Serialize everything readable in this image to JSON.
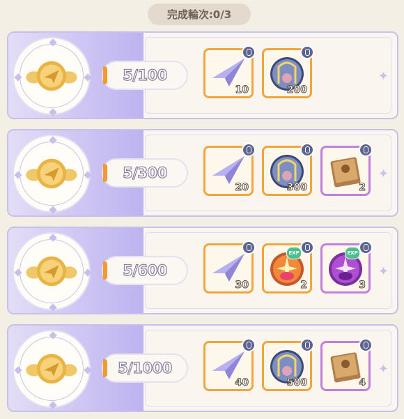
{
  "header": {
    "rounds_label": "完成輪次:0/3"
  },
  "tiers": [
    {
      "progress": "5/100",
      "progress_fraction": 0.05,
      "rewards": [
        {
          "icon": "paper-plane-icon",
          "count": "10",
          "frame": "orange"
        },
        {
          "icon": "crystal-ball-icon",
          "count": "200",
          "frame": "orange"
        }
      ]
    },
    {
      "progress": "5/300",
      "progress_fraction": 0.0167,
      "rewards": [
        {
          "icon": "paper-plane-icon",
          "count": "20",
          "frame": "orange"
        },
        {
          "icon": "crystal-ball-icon",
          "count": "300",
          "frame": "orange"
        },
        {
          "icon": "book-icon",
          "count": "2",
          "frame": "purple"
        }
      ]
    },
    {
      "progress": "5/600",
      "progress_fraction": 0.0083,
      "rewards": [
        {
          "icon": "paper-plane-icon",
          "count": "30",
          "frame": "orange"
        },
        {
          "icon": "exp-orb-orange-icon",
          "count": "2",
          "frame": "orange",
          "badge": "EXP"
        },
        {
          "icon": "exp-orb-purple-icon",
          "count": "3",
          "frame": "purple",
          "badge": "EXP"
        }
      ]
    },
    {
      "progress": "5/1000",
      "progress_fraction": 0.005,
      "rewards": [
        {
          "icon": "paper-plane-icon",
          "count": "40",
          "frame": "orange"
        },
        {
          "icon": "crystal-ball-icon",
          "count": "500",
          "frame": "orange"
        },
        {
          "icon": "book-icon",
          "count": "4",
          "frame": "purple"
        }
      ]
    }
  ],
  "colors": {
    "orange_frame": "#f3a53e",
    "purple_frame": "#c27fdc",
    "lock_badge": "#5e6491",
    "progress_fill": "#f29a2e"
  }
}
